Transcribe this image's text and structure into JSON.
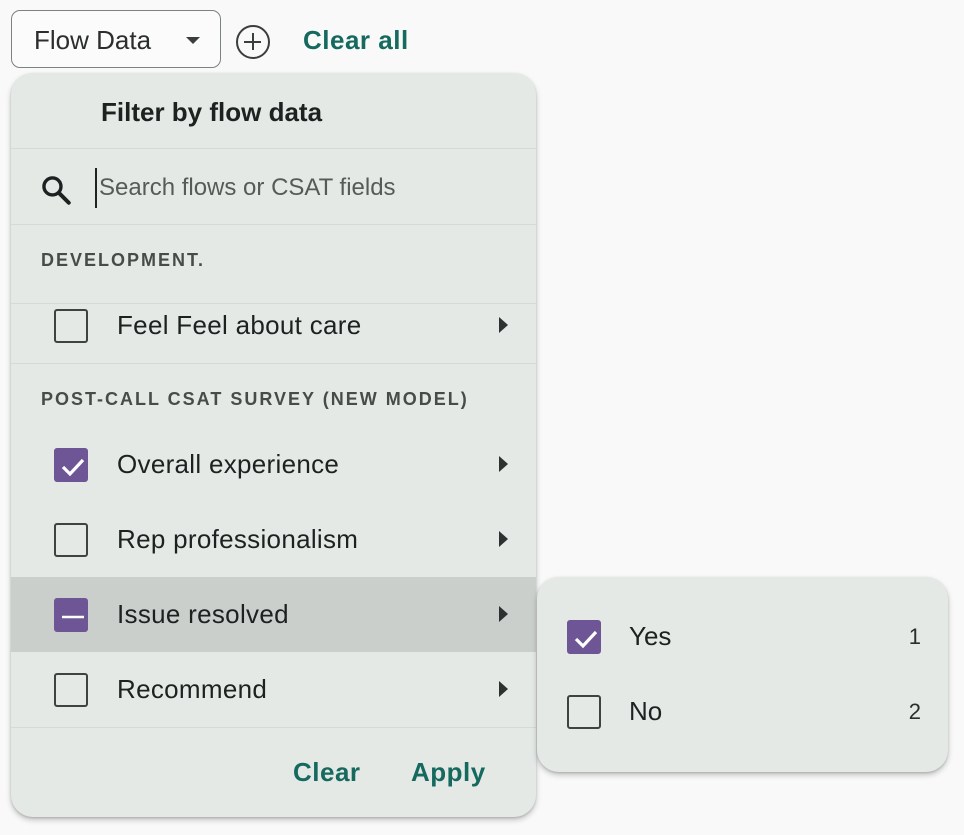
{
  "topbar": {
    "filter_button_label": "Flow Data",
    "clear_all_label": "Clear all"
  },
  "panel": {
    "title": "Filter by flow data",
    "search_placeholder": "Search flows or CSAT fields",
    "groups": [
      {
        "heading": "DEVELOPMENT.",
        "items": [
          {
            "label": "Feel Feel about care",
            "state": "unchecked"
          }
        ]
      },
      {
        "heading": "POST-CALL CSAT SURVEY (NEW MODEL)",
        "items": [
          {
            "label": "Overall experience",
            "state": "checked"
          },
          {
            "label": "Rep professionalism",
            "state": "unchecked"
          },
          {
            "label": "Issue resolved",
            "state": "indeterminate",
            "highlighted": true
          },
          {
            "label": "Recommend",
            "state": "unchecked"
          }
        ]
      }
    ],
    "clear_label": "Clear",
    "apply_label": "Apply"
  },
  "submenu": {
    "options": [
      {
        "label": "Yes",
        "count": "1",
        "state": "checked"
      },
      {
        "label": "No",
        "count": "2",
        "state": "unchecked"
      }
    ]
  },
  "colors": {
    "accent": "#15695e",
    "checkbox_fill": "#6d5596",
    "panel_bg": "#e5e9e6",
    "highlight_bg": "#cbcfcc"
  },
  "icons": {
    "dropdown": "caret-down-icon",
    "add": "add-circle-icon",
    "search": "search-icon",
    "submenu_arrow": "chevron-right-icon"
  }
}
